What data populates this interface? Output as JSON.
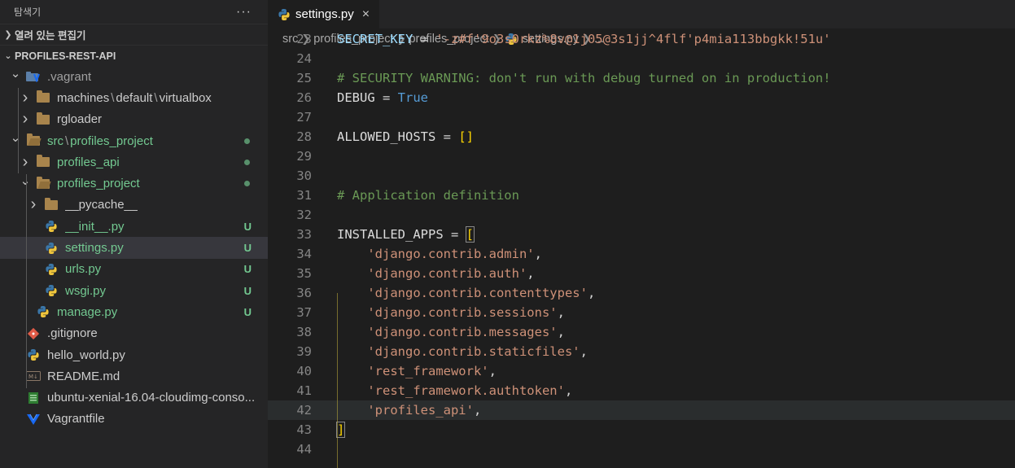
{
  "sidebar": {
    "title": "탐색기",
    "more": "···",
    "open_editors": "열려 있는 편집기",
    "project": "PROFILES-REST-API",
    "tree": [
      {
        "label": ".vagrant",
        "chev": "⌄",
        "icon": "vagrant-folder-icon",
        "depth": 1
      },
      {
        "label_parts": [
          "machines",
          "default",
          "virtualbox"
        ],
        "chev": "›",
        "icon": "folder-icon",
        "depth": 2
      },
      {
        "label": "rgloader",
        "chev": "›",
        "icon": "folder-icon",
        "depth": 2
      },
      {
        "label_parts": [
          "src",
          "profiles_project"
        ],
        "chev": "⌄",
        "icon": "folder-open-icon",
        "depth": 1,
        "status": "dot"
      },
      {
        "label": "profiles_api",
        "chev": "›",
        "icon": "folder-icon",
        "depth": 2,
        "status": "dot"
      },
      {
        "label": "profiles_project",
        "chev": "⌄",
        "icon": "folder-open-icon",
        "depth": 2,
        "status": "dot"
      },
      {
        "label": "__pycache__",
        "chev": "›",
        "icon": "folder-icon",
        "depth": 3
      },
      {
        "label": "__init__.py",
        "icon": "python-icon",
        "depth": 3,
        "status": "U"
      },
      {
        "label": "settings.py",
        "icon": "python-icon",
        "depth": 3,
        "status": "U",
        "selected": true
      },
      {
        "label": "urls.py",
        "icon": "python-icon",
        "depth": 3,
        "status": "U"
      },
      {
        "label": "wsgi.py",
        "icon": "python-icon",
        "depth": 3,
        "status": "U"
      },
      {
        "label": "manage.py",
        "icon": "python-icon",
        "depth": 2,
        "status": "U"
      },
      {
        "label": ".gitignore",
        "icon": "git-icon",
        "depth": 1
      },
      {
        "label": "hello_world.py",
        "icon": "python-icon",
        "depth": 1
      },
      {
        "label": "README.md",
        "icon": "markdown-icon",
        "depth": 1
      },
      {
        "label": "ubuntu-xenial-16.04-cloudimg-conso...",
        "icon": "log-icon",
        "depth": 1
      },
      {
        "label": "Vagrantfile",
        "icon": "vagrant-icon",
        "depth": 1
      }
    ]
  },
  "editor": {
    "tab": {
      "label": "settings.py",
      "close": "×"
    },
    "breadcrumb": [
      "src",
      "profiles_project",
      "profiles_project",
      "settings.py",
      "..."
    ],
    "lines": [
      {
        "n": "23",
        "tokens": [
          [
            "t-var",
            "SECRET_KEY"
          ],
          [
            "t-op",
            " = "
          ],
          [
            "t-str",
            "'-z#f'9o3s0rkz%8v@1j05@3s1jj^4flf'p4mia113bbgkk!51u'"
          ]
        ]
      },
      {
        "n": "24",
        "tokens": []
      },
      {
        "n": "25",
        "tokens": [
          [
            "t-com",
            "# SECURITY WARNING: don't run with debug turned on in production!"
          ]
        ]
      },
      {
        "n": "26",
        "tokens": [
          [
            "t-var2",
            "DEBUG"
          ],
          [
            "t-op",
            " = "
          ],
          [
            "t-const",
            "True"
          ]
        ]
      },
      {
        "n": "27",
        "tokens": []
      },
      {
        "n": "28",
        "tokens": [
          [
            "t-var2",
            "ALLOWED_HOSTS"
          ],
          [
            "t-op",
            " = "
          ],
          [
            "t-br",
            "[]"
          ]
        ]
      },
      {
        "n": "29",
        "tokens": []
      },
      {
        "n": "30",
        "tokens": []
      },
      {
        "n": "31",
        "tokens": [
          [
            "t-com",
            "# Application definition"
          ]
        ]
      },
      {
        "n": "32",
        "tokens": []
      },
      {
        "n": "33",
        "tokens": [
          [
            "t-var2",
            "INSTALLED_APPS"
          ],
          [
            "t-op",
            " = "
          ],
          [
            "t-br",
            "["
          ]
        ]
      },
      {
        "n": "34",
        "tokens": [
          [
            "t-c",
            "    "
          ],
          [
            "t-str",
            "'django.contrib.admin'"
          ],
          [
            "t-c",
            ","
          ]
        ]
      },
      {
        "n": "35",
        "tokens": [
          [
            "t-c",
            "    "
          ],
          [
            "t-str",
            "'django.contrib.auth'"
          ],
          [
            "t-c",
            ","
          ]
        ]
      },
      {
        "n": "36",
        "tokens": [
          [
            "t-c",
            "    "
          ],
          [
            "t-str",
            "'django.contrib.contenttypes'"
          ],
          [
            "t-c",
            ","
          ]
        ]
      },
      {
        "n": "37",
        "tokens": [
          [
            "t-c",
            "    "
          ],
          [
            "t-str",
            "'django.contrib.sessions'"
          ],
          [
            "t-c",
            ","
          ]
        ]
      },
      {
        "n": "38",
        "tokens": [
          [
            "t-c",
            "    "
          ],
          [
            "t-str",
            "'django.contrib.messages'"
          ],
          [
            "t-c",
            ","
          ]
        ]
      },
      {
        "n": "39",
        "tokens": [
          [
            "t-c",
            "    "
          ],
          [
            "t-str",
            "'django.contrib.staticfiles'"
          ],
          [
            "t-c",
            ","
          ]
        ]
      },
      {
        "n": "40",
        "tokens": [
          [
            "t-c",
            "    "
          ],
          [
            "t-str",
            "'rest_framework'"
          ],
          [
            "t-c",
            ","
          ]
        ]
      },
      {
        "n": "41",
        "tokens": [
          [
            "t-c",
            "    "
          ],
          [
            "t-str",
            "'rest_framework.authtoken'"
          ],
          [
            "t-c",
            ","
          ]
        ]
      },
      {
        "n": "42",
        "tokens": [
          [
            "t-c",
            "    "
          ],
          [
            "t-str",
            "'profiles_api'"
          ],
          [
            "t-c",
            ","
          ]
        ],
        "highlight": true
      },
      {
        "n": "43",
        "tokens": [
          [
            "t-br",
            "]"
          ]
        ]
      },
      {
        "n": "44",
        "tokens": []
      }
    ]
  },
  "colors": {
    "accent_green": "#73c991",
    "python_blue": "#3b77a8",
    "python_yellow": "#f0c63c"
  }
}
